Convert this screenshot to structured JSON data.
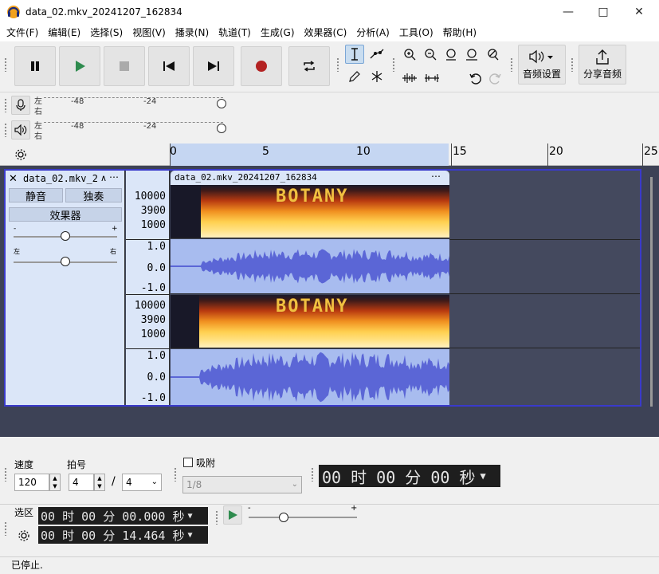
{
  "window": {
    "title": "data_02.mkv_20241207_162834"
  },
  "menu": [
    "文件(F)",
    "编辑(E)",
    "选择(S)",
    "视图(V)",
    "播录(N)",
    "轨道(T)",
    "生成(G)",
    "效果器(C)",
    "分析(A)",
    "工具(O)",
    "帮助(H)"
  ],
  "toolbar": {
    "audio_setup_label": "音频设置",
    "share_audio_label": "分享音频"
  },
  "meters": {
    "record_lr": [
      "左",
      "右"
    ],
    "play_lr": [
      "左",
      "右"
    ],
    "scale": [
      "-48",
      "-24"
    ]
  },
  "ruler": {
    "labels": [
      "0",
      "5",
      "10",
      "15",
      "20",
      "25"
    ]
  },
  "track": {
    "name": "data_02.mkv_2",
    "mute_label": "静音",
    "solo_label": "独奏",
    "effects_label": "效果器",
    "gain_minus": "-",
    "gain_plus": "+",
    "pan_left": "左",
    "pan_right": "右",
    "clip_title": "data_02.mkv_20241207_162834",
    "spec_scale": [
      "10000",
      "3900",
      "1000"
    ],
    "wave_scale": [
      "1.0",
      "0.0",
      "-1.0"
    ],
    "spec_text": "BOTANY"
  },
  "bottom": {
    "rate_label": "速度",
    "beat_label": "拍号",
    "rate_value": "120",
    "beat_num": "4",
    "beat_sep": "/",
    "beat_den": "4",
    "snap_label": "吸附",
    "snap_value": "1/8",
    "time_display": "00 时 00 分 00 秒",
    "selection_label": "选区",
    "sel_start": "00 时 00 分 00.000 秒",
    "sel_end": "00 时 00 分 14.464 秒",
    "play_minus": "-",
    "play_plus": "+"
  },
  "status": {
    "text": "已停止."
  }
}
